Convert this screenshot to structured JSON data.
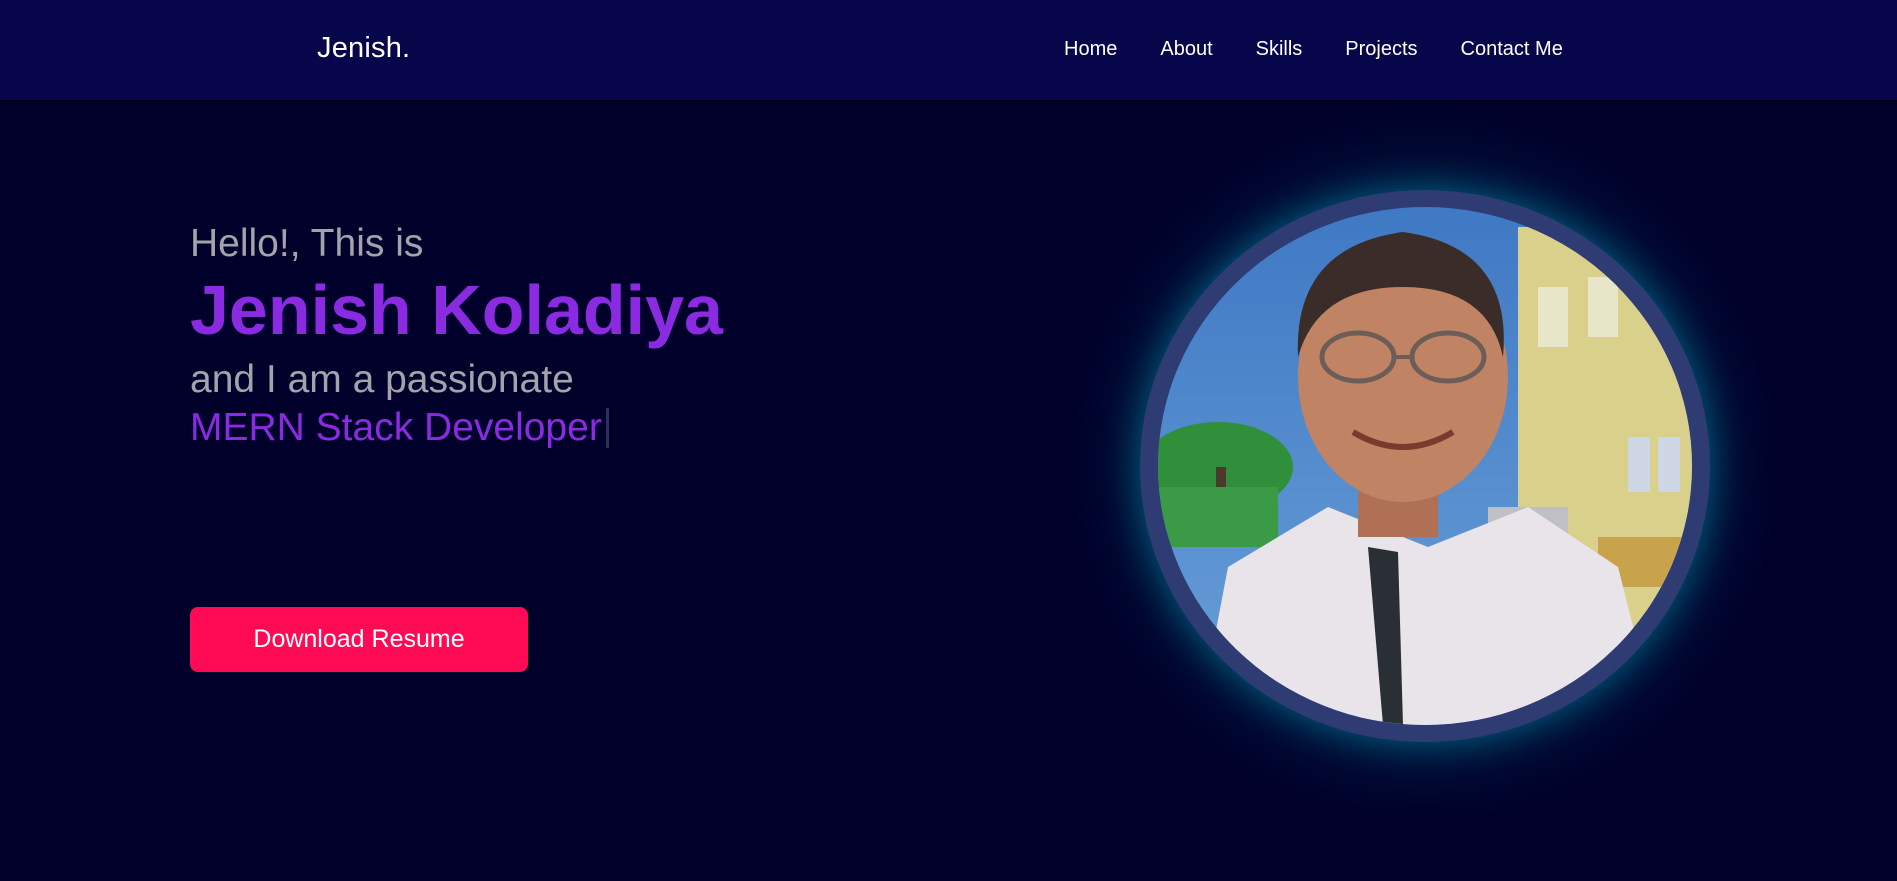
{
  "navbar": {
    "brand": "Jenish.",
    "links": [
      "Home",
      "About",
      "Skills",
      "Projects",
      "Contact Me"
    ]
  },
  "hero": {
    "greeting": "Hello!, This is",
    "name": "Jenish Koladiya",
    "passion_line": "and I am a passionate",
    "role": "MERN Stack Developer",
    "resume_button": "Download Resume"
  },
  "colors": {
    "background": "#00002a",
    "navbar": "#08064a",
    "accent_purple": "#8a2be2",
    "button": "#ff0a54",
    "glow": "#00bed2"
  },
  "image": {
    "alt": "profile-photo"
  }
}
